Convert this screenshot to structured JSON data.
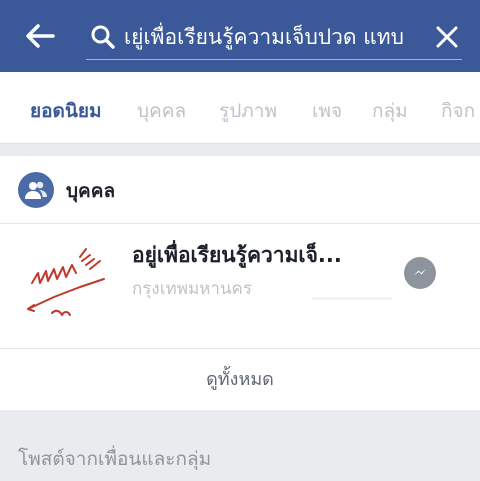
{
  "search": {
    "query": "เยู่เพื่อเรียนรู้ความเจ็บปวด แทบ"
  },
  "icons": {
    "back": "arrow-left-icon",
    "search": "search-icon",
    "clear": "close-icon",
    "people": "people-icon",
    "messenger": "messenger-icon"
  },
  "tabs": [
    {
      "label": "ยอดนิยม",
      "active": true
    },
    {
      "label": "บุคคล",
      "active": false
    },
    {
      "label": "รูปภาพ",
      "active": false
    },
    {
      "label": "เพจ",
      "active": false
    },
    {
      "label": "กลุ่ม",
      "active": false
    },
    {
      "label": "กิจก",
      "active": false
    }
  ],
  "people_section": {
    "title": "บุคคล",
    "results": [
      {
        "name": "อยู่เพื่อเรียนรู้ความเจ็...",
        "location": "กรุงเทพมหานคร"
      }
    ],
    "see_all_label": "ดูทั้งหมด"
  },
  "posts_section": {
    "title": "โพสต์จากเพื่อนและกลุ่ม"
  },
  "colors": {
    "brand_blue": "#3b5998",
    "inactive_tab": "#bec3c9",
    "background": "#e9ebee"
  }
}
